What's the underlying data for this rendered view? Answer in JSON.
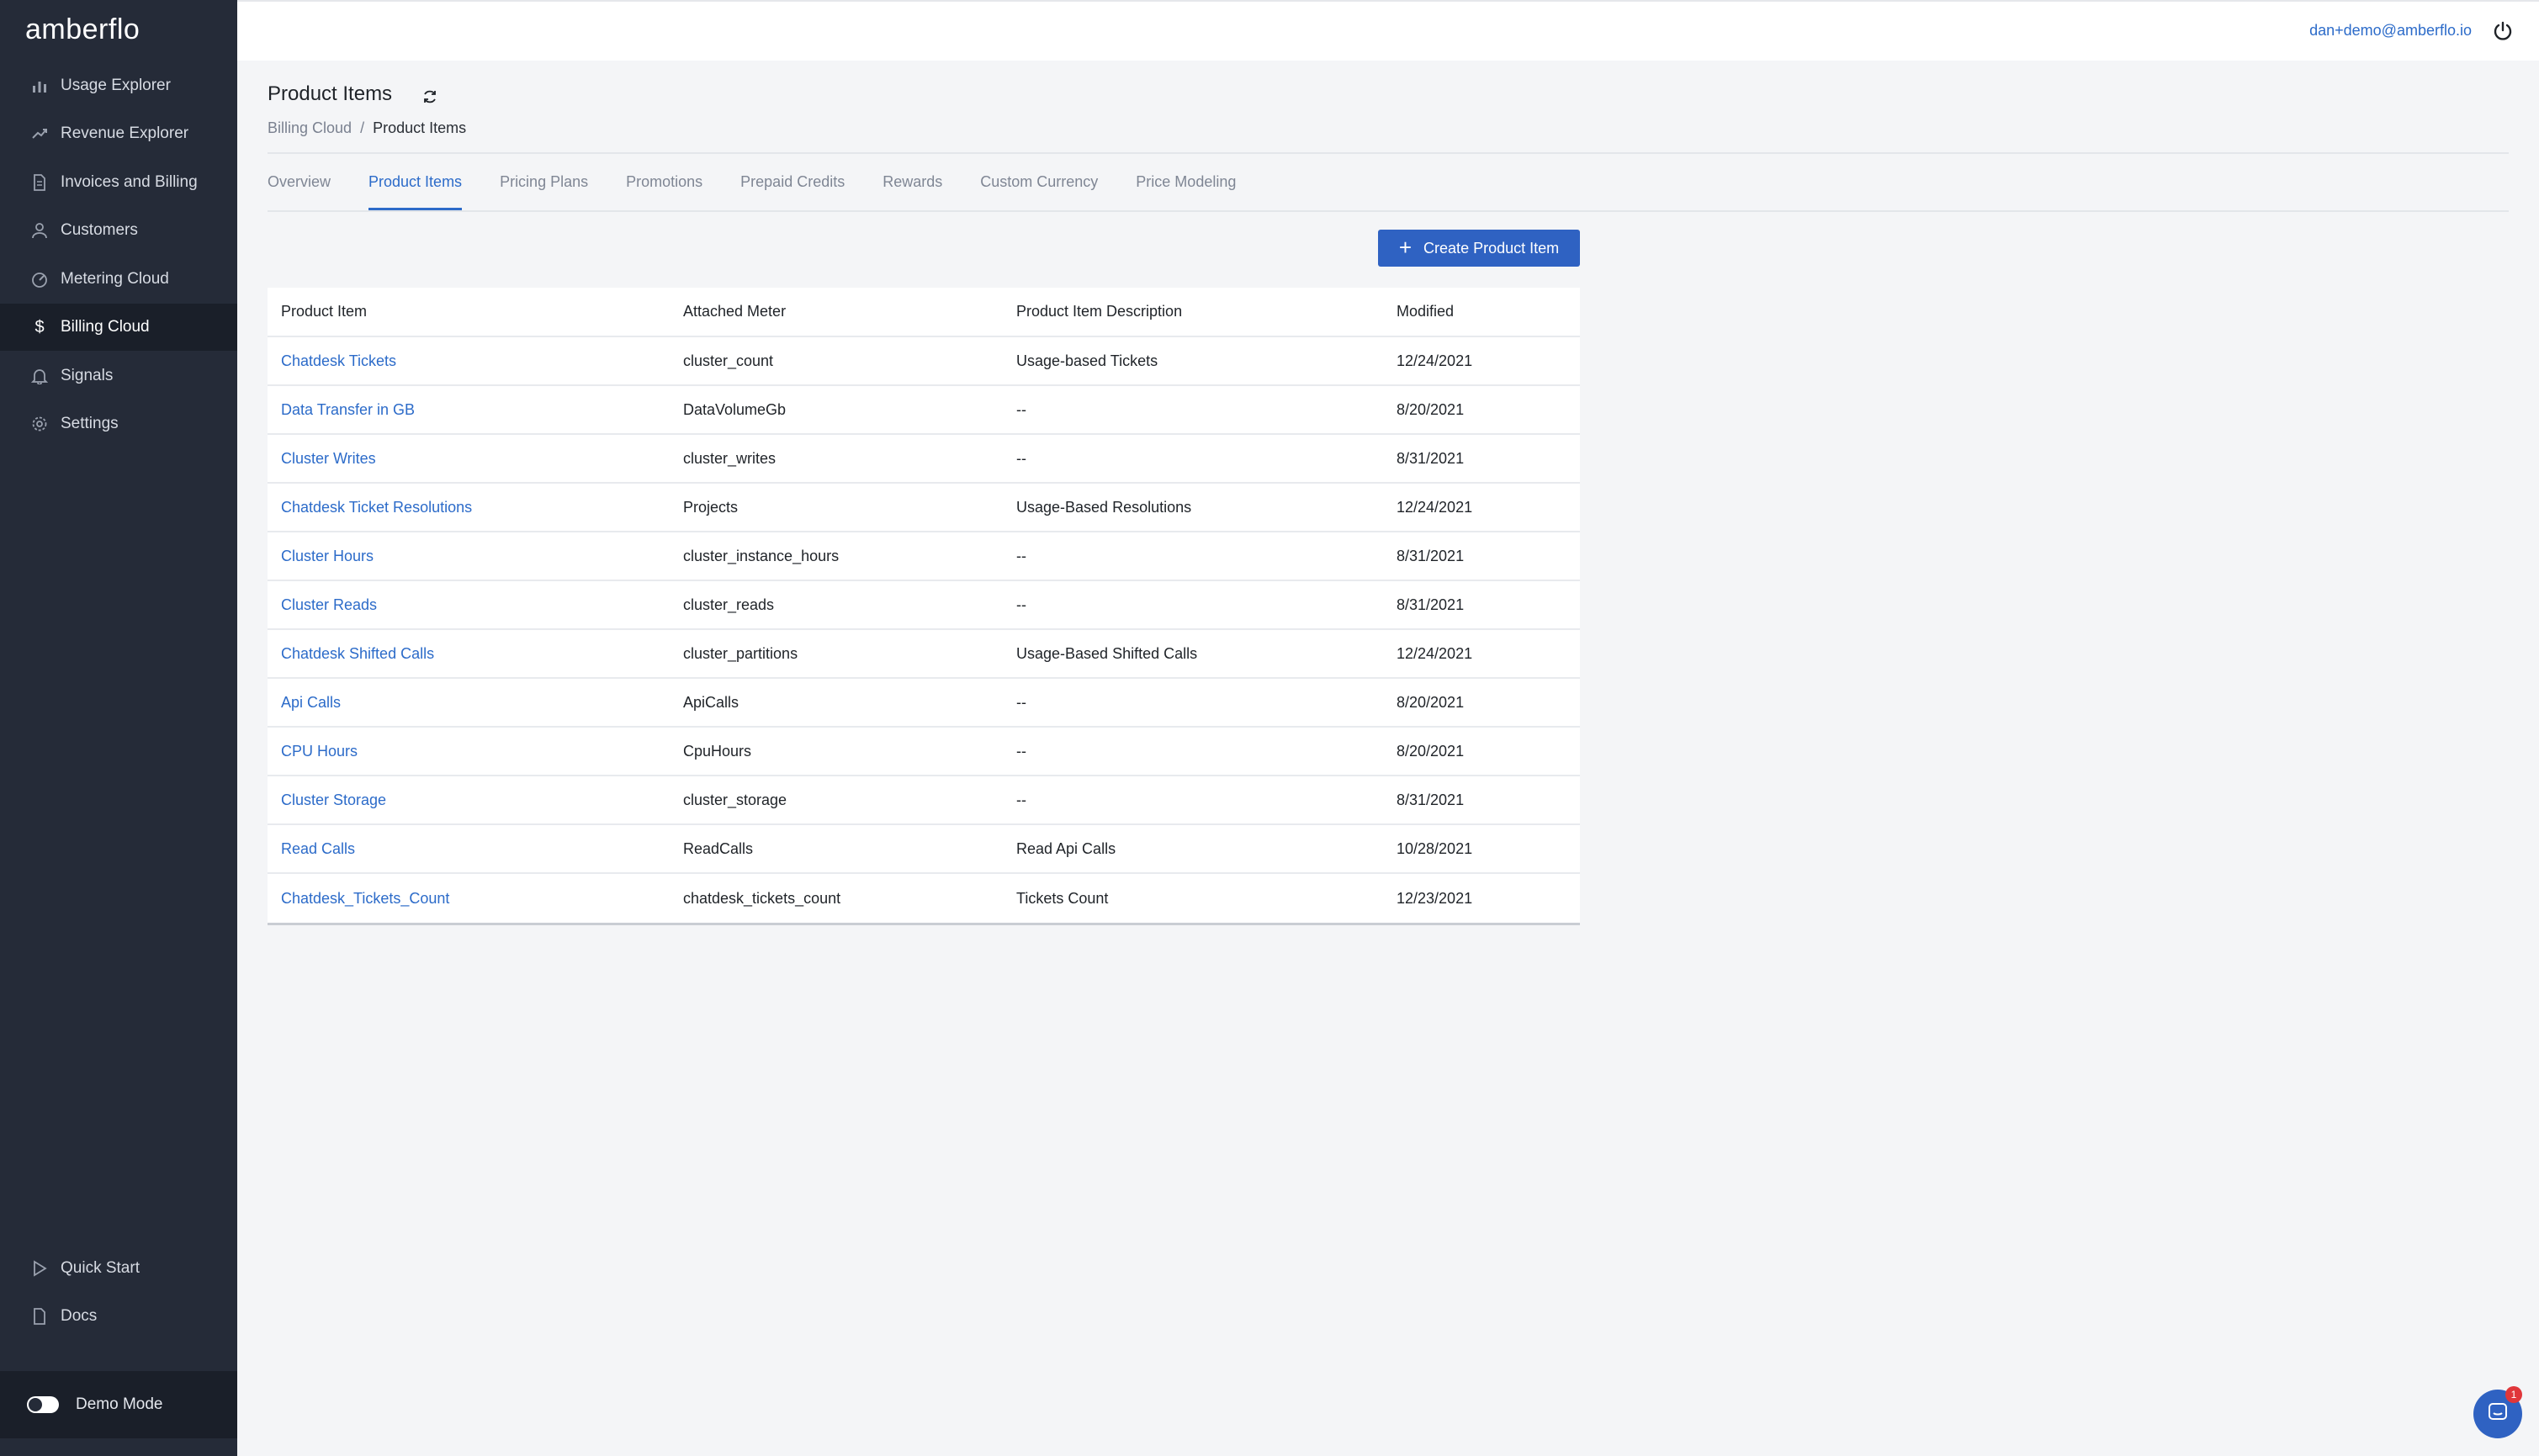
{
  "app": {
    "logo_text": "amberflo"
  },
  "sidebar": {
    "items": [
      {
        "label": "Usage Explorer",
        "icon": "bar-chart-icon"
      },
      {
        "label": "Revenue Explorer",
        "icon": "trend-icon"
      },
      {
        "label": "Invoices and Billing",
        "icon": "document-icon"
      },
      {
        "label": "Customers",
        "icon": "person-icon"
      },
      {
        "label": "Metering Cloud",
        "icon": "gauge-icon"
      },
      {
        "label": "Billing Cloud",
        "icon": "dollar-icon",
        "active": true
      },
      {
        "label": "Signals",
        "icon": "bell-icon"
      },
      {
        "label": "Settings",
        "icon": "gear-icon"
      }
    ],
    "bottom_items": [
      {
        "label": "Quick Start",
        "icon": "play-icon"
      },
      {
        "label": "Docs",
        "icon": "document-icon"
      }
    ],
    "demo_mode_label": "Demo Mode"
  },
  "topbar": {
    "user_email": "dan+demo@amberflo.io"
  },
  "header": {
    "title": "Product Items",
    "breadcrumb": [
      "Billing Cloud",
      "/",
      "Product Items"
    ]
  },
  "tabs": [
    {
      "label": "Overview"
    },
    {
      "label": "Product Items",
      "active": true
    },
    {
      "label": "Pricing Plans"
    },
    {
      "label": "Promotions"
    },
    {
      "label": "Prepaid Credits"
    },
    {
      "label": "Rewards"
    },
    {
      "label": "Custom Currency"
    },
    {
      "label": "Price Modeling"
    }
  ],
  "actions": {
    "create_label": "Create Product Item"
  },
  "table": {
    "columns": [
      "Product Item",
      "Attached Meter",
      "Product Item Description",
      "Modified"
    ],
    "rows": [
      [
        "Chatdesk Tickets",
        "cluster_count",
        "Usage-based Tickets",
        "12/24/2021"
      ],
      [
        "Data Transfer in GB",
        "DataVolumeGb",
        "--",
        "8/20/2021"
      ],
      [
        "Cluster Writes",
        "cluster_writes",
        "--",
        "8/31/2021"
      ],
      [
        "Chatdesk Ticket Resolutions",
        "Projects",
        "Usage-Based Resolutions",
        "12/24/2021"
      ],
      [
        "Cluster Hours",
        "cluster_instance_hours",
        "--",
        "8/31/2021"
      ],
      [
        "Cluster Reads",
        "cluster_reads",
        "--",
        "8/31/2021"
      ],
      [
        "Chatdesk Shifted Calls",
        "cluster_partitions",
        "Usage-Based Shifted Calls",
        "12/24/2021"
      ],
      [
        "Api Calls",
        "ApiCalls",
        "--",
        "8/20/2021"
      ],
      [
        "CPU Hours",
        "CpuHours",
        "--",
        "8/20/2021"
      ],
      [
        "Cluster Storage",
        "cluster_storage",
        "--",
        "8/31/2021"
      ],
      [
        "Read Calls",
        "ReadCalls",
        "Read Api Calls",
        "10/28/2021"
      ],
      [
        "Chatdesk_Tickets_Count",
        "chatdesk_tickets_count",
        "Tickets Count",
        "12/23/2021"
      ]
    ]
  },
  "chat": {
    "badge_count": "1"
  },
  "colors": {
    "accent": "#2c6bc9",
    "sidebar_bg": "#252b38",
    "logo_accent": "#f08a24"
  }
}
